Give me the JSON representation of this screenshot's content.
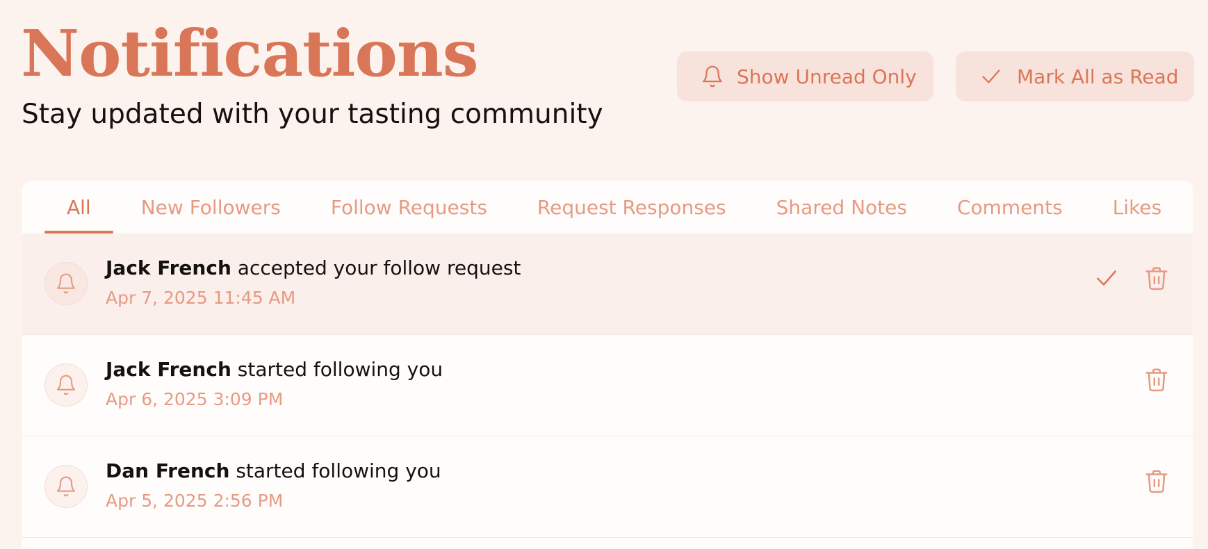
{
  "header": {
    "title": "Notifications",
    "subtitle": "Stay updated with your tasting community",
    "show_unread_label": "Show Unread Only",
    "mark_all_label": "Mark All as Read",
    "show_unread_icon": "bell-icon",
    "mark_all_icon": "check-icon"
  },
  "tabs": [
    {
      "label": "All",
      "active": true
    },
    {
      "label": "New Followers",
      "active": false
    },
    {
      "label": "Follow Requests",
      "active": false
    },
    {
      "label": "Request Responses",
      "active": false
    },
    {
      "label": "Shared Notes",
      "active": false
    },
    {
      "label": "Comments",
      "active": false
    },
    {
      "label": "Likes",
      "active": false
    }
  ],
  "notifications": [
    {
      "user": "Jack French",
      "action": " accepted your follow request",
      "time": "Apr 7, 2025 11:45 AM",
      "unread": true,
      "icon": "bell-icon"
    },
    {
      "user": "Jack French",
      "action": " started following you",
      "time": "Apr 6, 2025 3:09 PM",
      "unread": false,
      "icon": "bell-icon"
    },
    {
      "user": "Dan French",
      "action": " started following you",
      "time": "Apr 5, 2025 2:56 PM",
      "unread": false,
      "icon": "bell-icon"
    }
  ],
  "colors": {
    "accent": "#d97657",
    "accent_light": "#e69a82",
    "background": "#fcf3ef",
    "button_bg": "#f8e3dc",
    "unread_row_bg": "#faefeb",
    "panel_bg": "#fffdfc"
  }
}
